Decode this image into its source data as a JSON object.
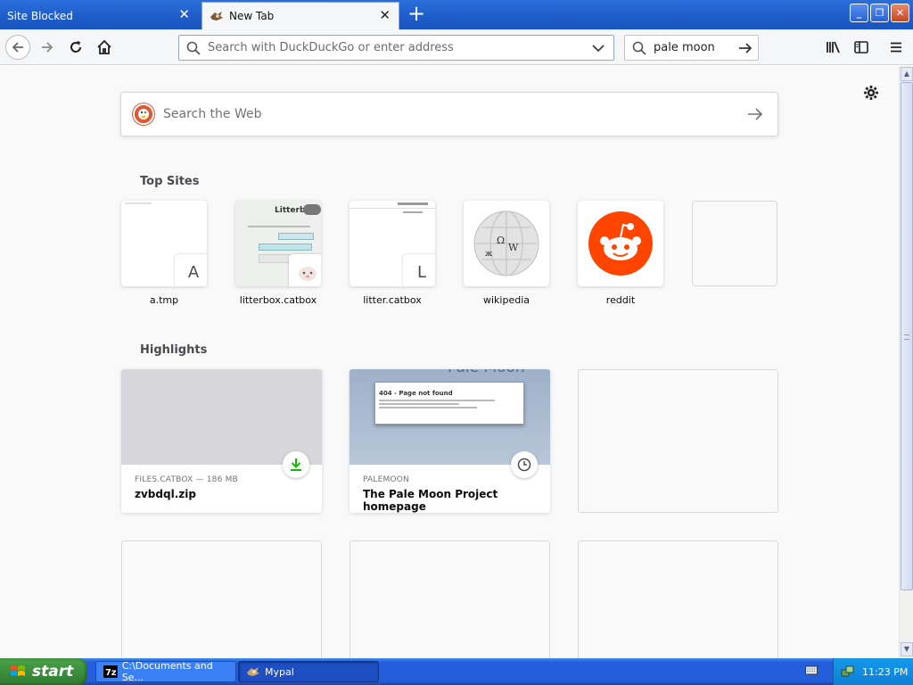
{
  "tabs": [
    {
      "label": "Site Blocked",
      "active": false
    },
    {
      "label": "New Tab",
      "active": true
    }
  ],
  "navbar": {
    "url_placeholder": "Search with DuckDuckGo or enter address",
    "search_value": "pale moon"
  },
  "newtab": {
    "websearch_placeholder": "Search the Web",
    "top_sites_title": "Top Sites",
    "top_sites": [
      {
        "label": "a.tmp",
        "badge": "A"
      },
      {
        "label": "litterbox.catbox",
        "badge": ""
      },
      {
        "label": "litter.catbox",
        "badge": "L"
      },
      {
        "label": "wikipedia",
        "badge": ""
      },
      {
        "label": "reddit",
        "badge": ""
      },
      {
        "label": "",
        "badge": ""
      }
    ],
    "highlights_title": "Highlights",
    "highlights": [
      {
        "host": "FILES.CATBOX — 186 MB",
        "title": "zvbdql.zip",
        "icon": "download-icon"
      },
      {
        "host": "PALEMOON",
        "title": "The Pale Moon Project homepage",
        "icon": "clock-icon"
      }
    ],
    "thumb_texts": {
      "litterbox_logo": "Litterbox",
      "palemoon_heading": "Pale Moon",
      "palemoon_404": "404 - Page not found"
    }
  },
  "taskbar": {
    "start_label": "start",
    "tasks": [
      {
        "label": "C:\\Documents and Se..."
      },
      {
        "label": "Mypal"
      }
    ],
    "clock": "11:23 PM"
  },
  "colors": {
    "accent": "#245edb",
    "ddg": "#de5833",
    "reddit": "#ff4500",
    "download_green": "#12bc00"
  }
}
